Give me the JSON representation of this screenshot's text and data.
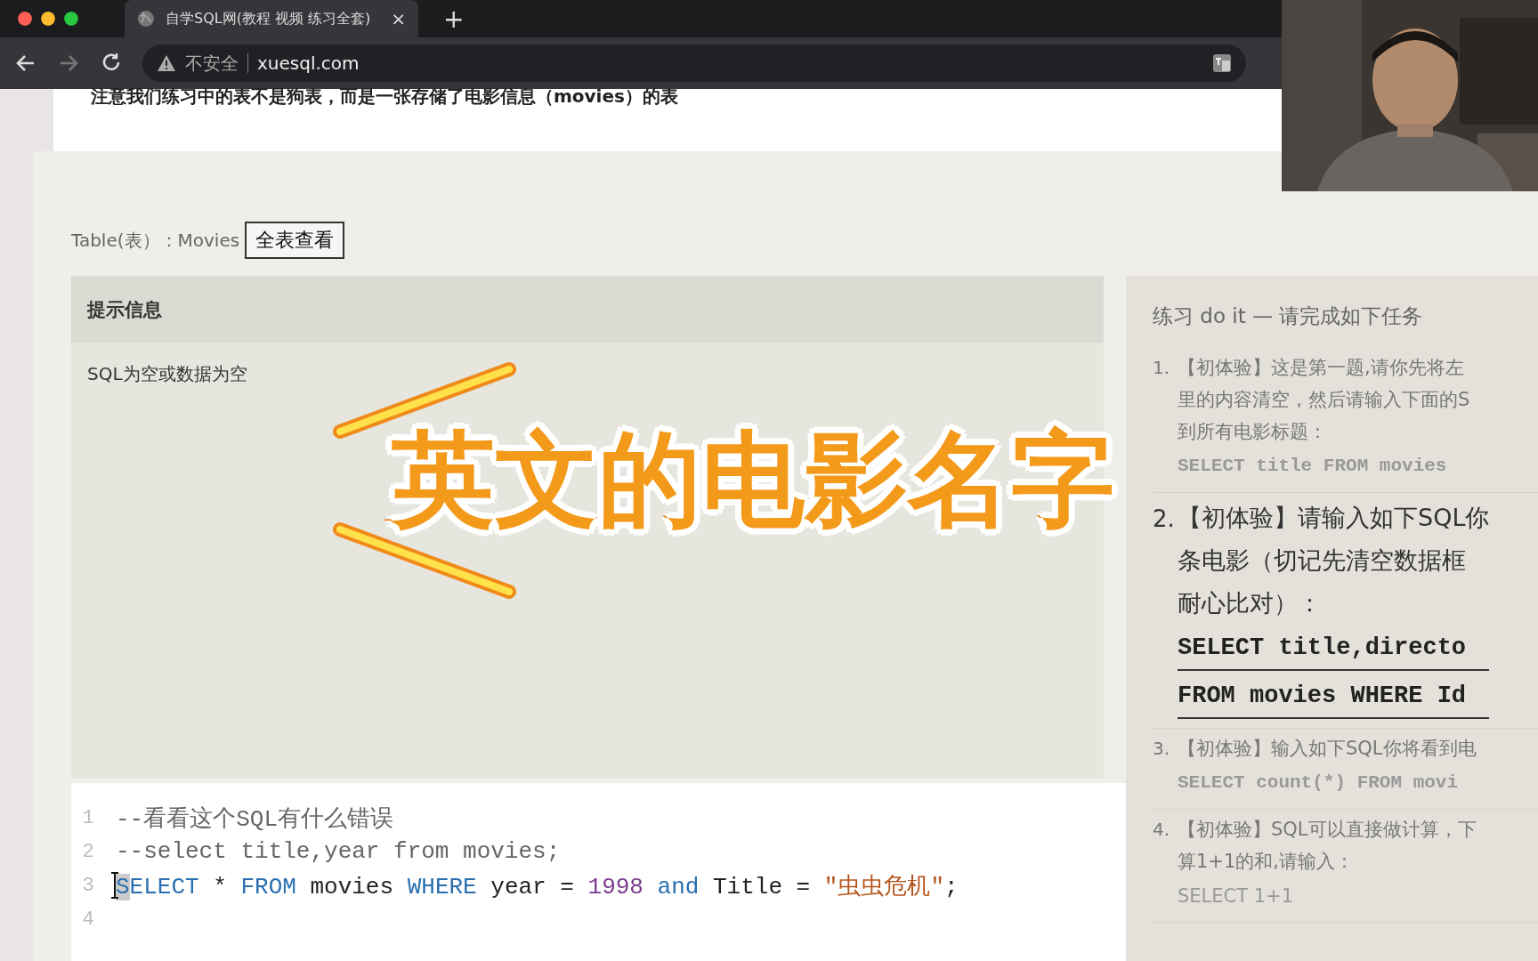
{
  "browser": {
    "tab_title": "自学SQL网(教程 视频 练习全套)",
    "tab_close": "×",
    "new_tab": "+",
    "security": "不安全",
    "url": "xuesql.com"
  },
  "page": {
    "notice": "注意我们练习中的表不是狗表，而是一张存储了电影信息（movies）的表",
    "table_label": "Table(表）：Movies",
    "view_button": "全表查看",
    "hint_panel": {
      "title": "提示信息",
      "message": "SQL为空或数据为空"
    },
    "editor": {
      "lines": [
        {
          "number": "1",
          "tokens": [
            {
              "kind": "comment",
              "text": "--看看这个SQL有什么错误"
            }
          ]
        },
        {
          "number": "2",
          "tokens": [
            {
              "kind": "comment",
              "text": "--select title,year from movies;"
            }
          ]
        },
        {
          "number": "3",
          "tokens": [
            {
              "kind": "keyword",
              "text": "SELECT"
            },
            {
              "kind": "plain",
              "text": " * "
            },
            {
              "kind": "keyword",
              "text": "FROM"
            },
            {
              "kind": "plain",
              "text": " movies "
            },
            {
              "kind": "keyword",
              "text": "WHERE"
            },
            {
              "kind": "plain",
              "text": " year = "
            },
            {
              "kind": "number",
              "text": "1998"
            },
            {
              "kind": "keyword",
              "text": " and"
            },
            {
              "kind": "plain",
              "text": " Title = "
            },
            {
              "kind": "string",
              "text": "\"虫虫危机\""
            },
            {
              "kind": "plain",
              "text": ";"
            }
          ]
        },
        {
          "number": "4"
        }
      ]
    },
    "exercises": {
      "title": "练习 do it — 请完成如下任务",
      "tasks": [
        {
          "number": "1.",
          "emphasized": false,
          "lines": [
            "【初体验】这是第一题,请你先将左",
            "里的内容清空，然后请输入下面的S",
            "到所有电影标题："
          ],
          "code": [
            "SELECT title FROM movies"
          ],
          "monospace": true
        },
        {
          "number": "2.",
          "emphasized": true,
          "lines": [
            "【初体验】请输入如下SQL你",
            "条电影（切记先清空数据框",
            "耐心比对）："
          ],
          "code": [
            "SELECT title,directo",
            "FROM movies WHERE Id"
          ],
          "monospace": true
        },
        {
          "number": "3.",
          "emphasized": false,
          "lines": [
            "【初体验】输入如下SQL你将看到电"
          ],
          "code": [
            "SELECT count(*) FROM movi"
          ],
          "monospace": true
        },
        {
          "number": "4.",
          "emphasized": false,
          "lines": [
            "【初体验】SQL可以直接做计算，下",
            "算1+1的和,请输入："
          ],
          "code": [
            "SELECT 1+1"
          ],
          "monospace": false
        }
      ]
    }
  },
  "caption": "英文的电影名字"
}
